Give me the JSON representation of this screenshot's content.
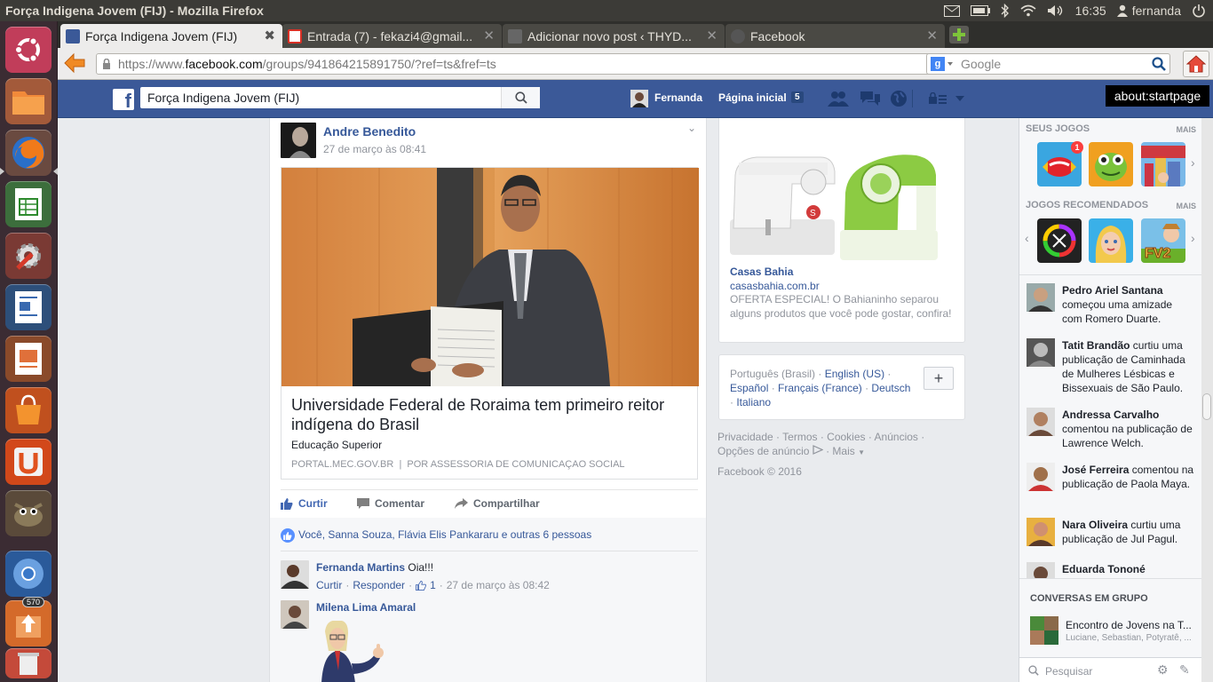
{
  "window": {
    "title": "Força Indigena Jovem (FIJ) - Mozilla Firefox"
  },
  "system": {
    "time": "16:35",
    "user": "fernanda"
  },
  "launcher": {
    "badge": "570"
  },
  "tabs": [
    {
      "label": "Força Indigena Jovem (FIJ)",
      "active": true
    },
    {
      "label": "Entrada (7) - fekazi4@gmail...",
      "active": false
    },
    {
      "label": "Adicionar novo post ‹ THYD...",
      "active": false
    },
    {
      "label": "Facebook",
      "active": false
    }
  ],
  "addressbar": {
    "scheme": "https://www.",
    "domain": "facebook.com",
    "path": "/groups/941864215891750/?ref=ts&fref=ts"
  },
  "websearch": {
    "placeholder": "Google"
  },
  "fb": {
    "search_value": "Força Indigena Jovem (FIJ)",
    "profile_name": "Fernanda",
    "home_label": "Página inicial",
    "home_count": "5",
    "tooltip": "about:startpage"
  },
  "post": {
    "author": "Andre Benedito",
    "time": "27 de março às 08:41",
    "link_title": "Universidade Federal de Roraima tem primeiro reitor indígena do Brasil",
    "link_subtitle": "Educação Superior",
    "link_source": "PORTAL.MEC.GOV.BR  |  POR ASSESSORIA DE COMUNICAÇAO SOCIAL",
    "like_label": "Curtir",
    "comment_label": "Comentar",
    "share_label": "Compartilhar",
    "likes_text": "Você, Sanna Souza, Flávia Elis Pankararu e outras 6 pessoas"
  },
  "comments": [
    {
      "author": "Fernanda Martins",
      "text": "Oia!!!",
      "reply_like": "Curtir",
      "reply": "Responder",
      "likes": "1",
      "time": "27 de março às 08:42"
    },
    {
      "author": "Milena Lima Amaral"
    }
  ],
  "ad": {
    "title": "Casas Bahia",
    "url": "casasbahia.com.br",
    "text": "OFERTA ESPECIAL! O Bahianinho separou alguns produtos que você pode gostar, confira!"
  },
  "languages": {
    "current": "Português (Brasil)",
    "l1": "English (US)",
    "l2": "Español",
    "l3": "Français (France)",
    "l4": "Deutsch",
    "l5": "Italiano",
    "add": "+"
  },
  "footer": {
    "privacy": "Privacidade",
    "terms": "Termos",
    "cookies": "Cookies",
    "ads": "Anúncios",
    "adchoices": "Opções de anúncio",
    "more": "Mais",
    "copyright": "Facebook © 2016"
  },
  "sidebar": {
    "my_games": "SEUS JOGOS",
    "recommended": "JOGOS RECOMENDADOS",
    "more": "MAIS",
    "badge": "1",
    "ticker": [
      {
        "name": "Pedro Ariel Santana",
        "rest": " começou uma amizade com Romero Duarte."
      },
      {
        "name": "Tatit Brandão",
        "rest": " curtiu uma publicação de Caminhada de Mulheres Lésbicas e Bissexuais de São Paulo."
      },
      {
        "name": "Andressa Carvalho",
        "rest": " comentou na publicação de Lawrence Welch."
      },
      {
        "name": "José Ferreira",
        "rest": " comentou na publicação de Paola Maya."
      },
      {
        "name": "Nara Oliveira",
        "rest": " curtiu uma publicação de Jul Pagul."
      },
      {
        "name": "Eduarda Tononé",
        "rest": ""
      }
    ],
    "group_chats": "CONVERSAS EM GRUPO",
    "chat_name": "Encontro de Jovens na T...",
    "chat_members": "Luciane, Sebastian, Potyratê, ...",
    "chat_search": "Pesquisar"
  },
  "colors": {
    "fb_blue": "#3b5998",
    "link": "#365899"
  }
}
